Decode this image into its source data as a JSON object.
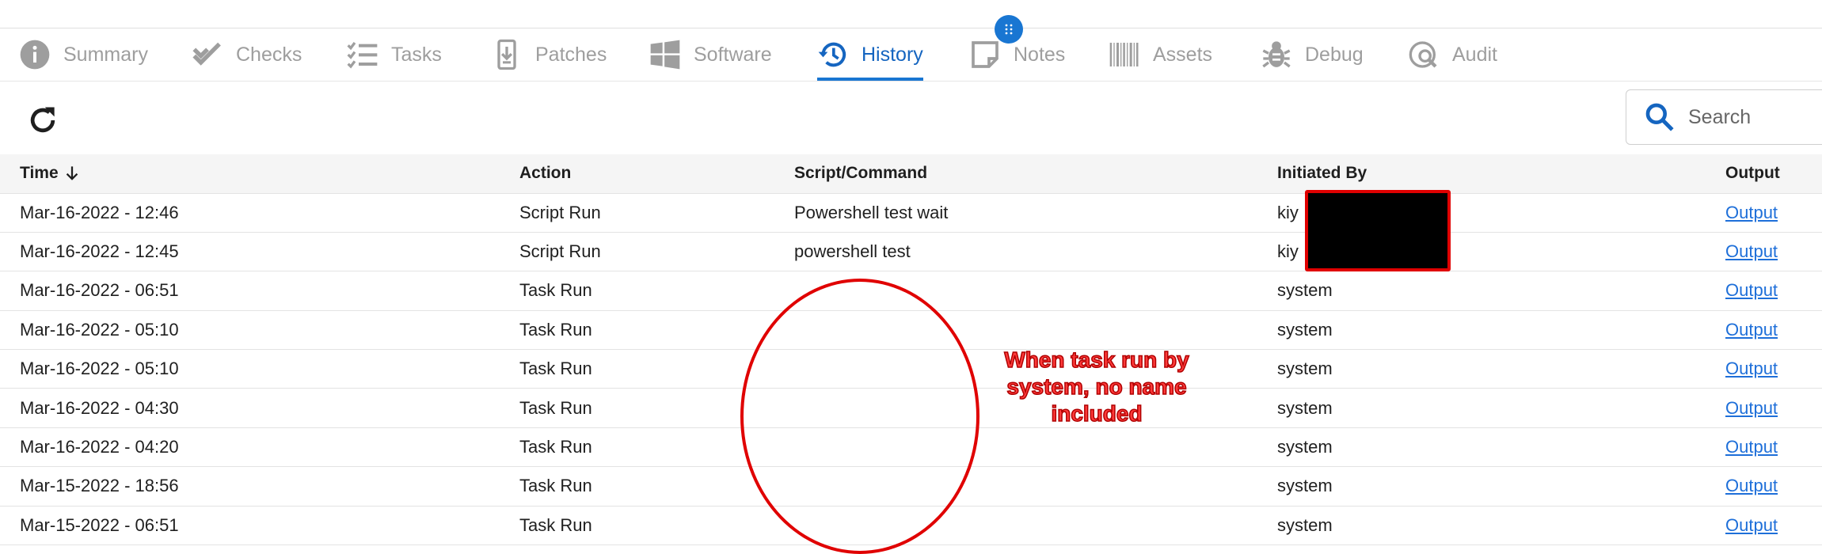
{
  "tabs": [
    {
      "label": "Summary",
      "icon": "info-icon"
    },
    {
      "label": "Checks",
      "icon": "double-check-icon"
    },
    {
      "label": "Tasks",
      "icon": "checklist-icon"
    },
    {
      "label": "Patches",
      "icon": "download-icon"
    },
    {
      "label": "Software",
      "icon": "windows-icon"
    },
    {
      "label": "History",
      "icon": "history-icon",
      "active": true
    },
    {
      "label": "Notes",
      "icon": "note-icon"
    },
    {
      "label": "Assets",
      "icon": "barcode-icon"
    },
    {
      "label": "Debug",
      "icon": "bug-icon"
    },
    {
      "label": "Audit",
      "icon": "audit-icon"
    }
  ],
  "toolbar": {
    "search_placeholder": "Search"
  },
  "table": {
    "headers": {
      "time": "Time",
      "action": "Action",
      "script": "Script/Command",
      "initiated_by": "Initiated By",
      "output": "Output"
    },
    "rows": [
      {
        "time": "Mar-16-2022 - 12:46",
        "action": "Script Run",
        "script": "Powershell test wait",
        "initiated_by": "kiy",
        "output": "Output"
      },
      {
        "time": "Mar-16-2022 - 12:45",
        "action": "Script Run",
        "script": "powershell test",
        "initiated_by": "kiy",
        "output": "Output"
      },
      {
        "time": "Mar-16-2022 - 06:51",
        "action": "Task Run",
        "script": "",
        "initiated_by": "system",
        "output": "Output"
      },
      {
        "time": "Mar-16-2022 - 05:10",
        "action": "Task Run",
        "script": "",
        "initiated_by": "system",
        "output": "Output"
      },
      {
        "time": "Mar-16-2022 - 05:10",
        "action": "Task Run",
        "script": "",
        "initiated_by": "system",
        "output": "Output"
      },
      {
        "time": "Mar-16-2022 - 04:30",
        "action": "Task Run",
        "script": "",
        "initiated_by": "system",
        "output": "Output"
      },
      {
        "time": "Mar-16-2022 - 04:20",
        "action": "Task Run",
        "script": "",
        "initiated_by": "system",
        "output": "Output"
      },
      {
        "time": "Mar-15-2022 - 18:56",
        "action": "Task Run",
        "script": "",
        "initiated_by": "system",
        "output": "Output"
      },
      {
        "time": "Mar-15-2022 - 06:51",
        "action": "Task Run",
        "script": "",
        "initiated_by": "system",
        "output": "Output"
      }
    ]
  },
  "annotation": {
    "text": "When task run by system, no name included"
  },
  "colors": {
    "accent": "#1976d2",
    "annotation": "#e00000",
    "link": "#1e6fd9"
  }
}
